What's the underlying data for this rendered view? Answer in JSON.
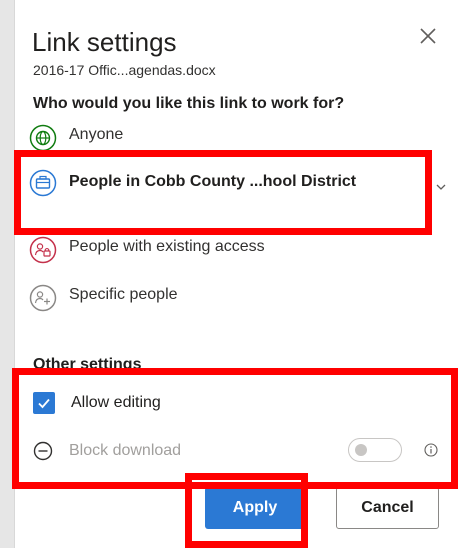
{
  "dialog": {
    "title": "Link settings",
    "filename": "2016-17 Offic...agendas.docx",
    "question": "Who would you like this link to work for?",
    "options": [
      {
        "label": "Anyone",
        "icon": "globe-icon",
        "color": "#107c10"
      },
      {
        "label": "People in Cobb County ...hool District",
        "icon": "briefcase-icon",
        "color": "#2b79d4",
        "selected": true
      },
      {
        "label": "People with existing access",
        "icon": "people-lock-icon",
        "color": "#c4314b"
      },
      {
        "label": "Specific people",
        "icon": "people-add-icon",
        "color": "#8a8886"
      }
    ],
    "other_settings": {
      "header": "Other settings",
      "allow_editing": {
        "label": "Allow editing",
        "checked": true
      },
      "block_download": {
        "label": "Block download",
        "enabled": false
      }
    },
    "buttons": {
      "apply": "Apply",
      "cancel": "Cancel"
    }
  },
  "colors": {
    "accent": "#2b79d4",
    "highlight": "#ff0000"
  }
}
